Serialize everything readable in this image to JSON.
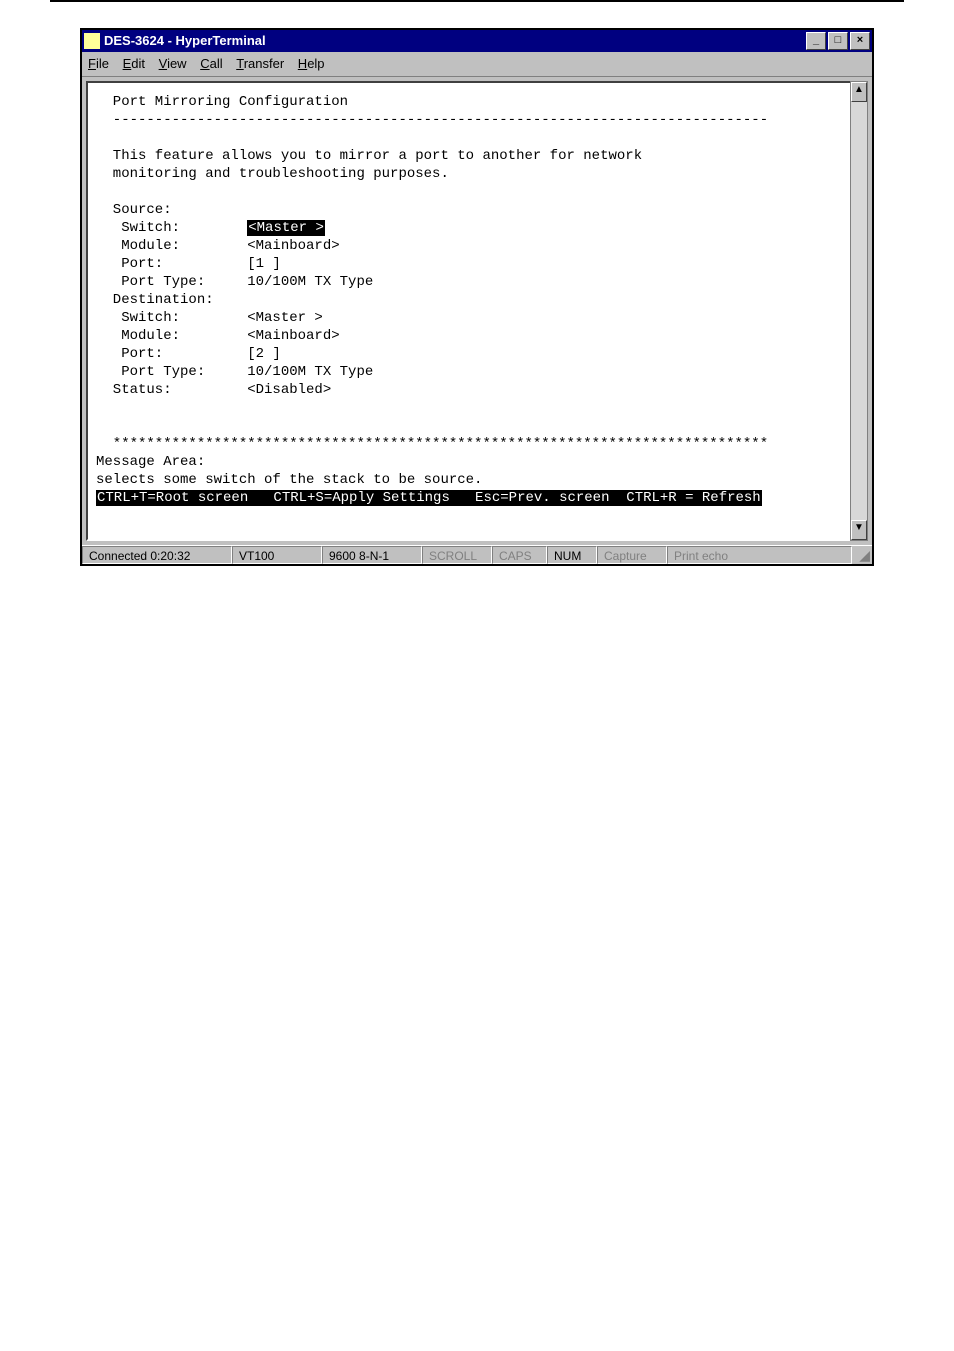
{
  "window": {
    "title": "DES-3624 - HyperTerminal",
    "minimize_label": "_",
    "maximize_label": "□",
    "close_label": "×"
  },
  "menubar": {
    "file": "File",
    "edit": "Edit",
    "view": "View",
    "call": "Call",
    "transfer": "Transfer",
    "help": "Help"
  },
  "terminal": {
    "title_line": "  Port Mirroring Configuration",
    "hr": "  ------------------------------------------------------------------------------",
    "desc1": "  This feature allows you to mirror a port to another for network",
    "desc2": "  monitoring and troubleshooting purposes.",
    "source_label": "  Source:",
    "src_switch_label": "   Switch:        ",
    "src_switch_val": "<Master >",
    "src_module": "   Module:        <Mainboard>",
    "src_port": "   Port:          [1 ]",
    "src_port_type": "   Port Type:     10/100M TX Type",
    "dest_label": "  Destination:",
    "dst_switch": "   Switch:        <Master >",
    "dst_module": "   Module:        <Mainboard>",
    "dst_port": "   Port:          [2 ]",
    "dst_port_type": "   Port Type:     10/100M TX Type",
    "status": "  Status:         <Disabled>",
    "stars": "  ******************************************************************************",
    "msg_area": "Message Area:",
    "msg_text": "selects some switch of the stack to be source.",
    "footer": "CTRL+T=Root screen   CTRL+S=Apply Settings   Esc=Prev. screen  CTRL+R = Refresh"
  },
  "statusbar": {
    "connected": "Connected 0:20:32",
    "emulation": "VT100",
    "settings": "9600 8-N-1",
    "scroll": "SCROLL",
    "caps": "CAPS",
    "num": "NUM",
    "capture": "Capture",
    "print_echo": "Print echo"
  },
  "scroll": {
    "up": "▲",
    "down": "▼"
  }
}
